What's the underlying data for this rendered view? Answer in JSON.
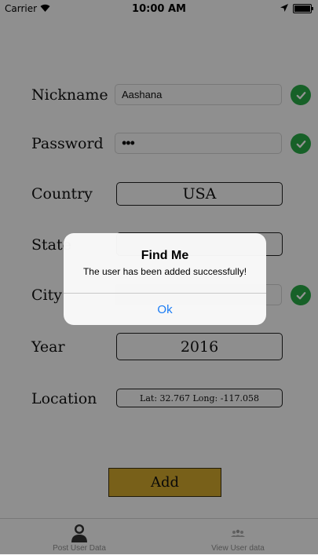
{
  "status_bar": {
    "carrier": "Carrier",
    "time": "10:00 AM"
  },
  "form": {
    "nickname": {
      "label": "Nickname",
      "value": "Aashana"
    },
    "password": {
      "label": "Password",
      "value": "•••"
    },
    "country": {
      "label": "Country",
      "value": "USA"
    },
    "state": {
      "label": "State",
      "value": ""
    },
    "city": {
      "label": "City",
      "value": ""
    },
    "year": {
      "label": "Year",
      "value": "2016"
    },
    "location": {
      "label": "Location",
      "value": "Lat: 32.767 Long: -117.058"
    },
    "add_button": "Add"
  },
  "tabs": [
    {
      "label": "Post User Data",
      "icon": "person-icon"
    },
    {
      "label": "View User data",
      "icon": "group-icon"
    }
  ],
  "alert": {
    "title": "Find Me",
    "message": "The user has been added successfully!",
    "ok_label": "Ok"
  },
  "colors": {
    "accent": "#cfa52c",
    "check": "#28a745",
    "link": "#1a7cf5"
  }
}
